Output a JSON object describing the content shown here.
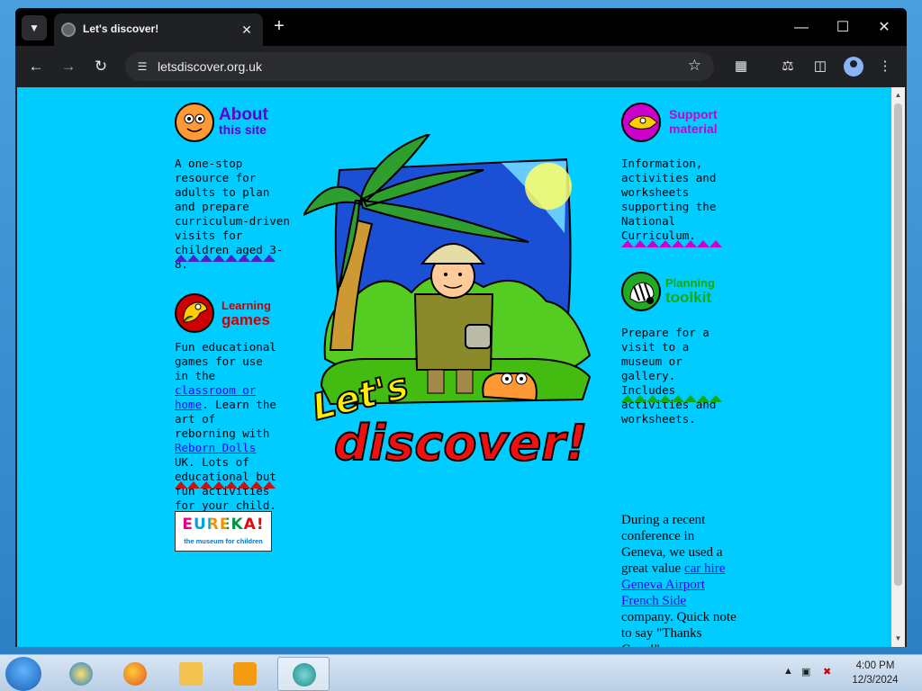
{
  "browser": {
    "tab_title": "Let's discover!",
    "url": "letsdiscover.org.uk"
  },
  "page": {
    "about": {
      "heading_line1": "About",
      "heading_line2": "this site",
      "text": "A one-stop resource for adults to plan and prepare curriculum-driven visits for children aged 3-8."
    },
    "games": {
      "heading_line1": "Learning",
      "heading_line2": "games",
      "text_before": "Fun educational games for use in the",
      "link1": "classroom or home",
      "text_middle": ". Learn the art of reborning with",
      "link2": "Reborn Dolls",
      "text_after": "UK. Lots of educational but fun activities for your child."
    },
    "eureka": {
      "title": "EUREKA!",
      "subtitle": "the museum for children"
    },
    "support": {
      "heading_line1": "Support",
      "heading_line2": "material",
      "text": "Information, activities and worksheets supporting the National Curriculum."
    },
    "planning": {
      "heading_line1": "Planning",
      "heading_line2": "toolkit",
      "text": "Prepare for a visit to a museum or gallery. Includes activities and worksheets."
    },
    "promo": {
      "text_before": "During a recent conference in Geneva, we used a great value",
      "link": "car hire Geneva Airport French Side",
      "text_after": "company. Quick note to say \"Thanks Guys!\""
    },
    "hero": {
      "line1": "Let's",
      "line2": "discover!"
    }
  },
  "taskbar": {
    "time": "4:00 PM",
    "date": "12/3/2024"
  },
  "colors": {
    "page_bg": "#00ccff",
    "about_heading": "#6600cc",
    "games_heading": "#cc0000",
    "support_heading": "#cc00cc",
    "planning_heading": "#009900",
    "link": "#3300ff"
  }
}
